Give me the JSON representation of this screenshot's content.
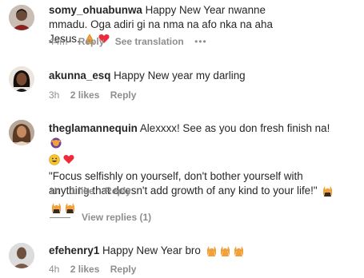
{
  "comments": [
    {
      "username": "somy_ohuabunwa",
      "text": "Happy New Year nwanne mmadu. Oga adiri gi na nma na afo nka na aha Jesus.",
      "time": "44m",
      "reply": "Reply",
      "see_translation": "See translation",
      "more": "•••",
      "emojis": [
        "folded-hands",
        "red-heart"
      ]
    },
    {
      "username": "akunna_esq",
      "text": "Happy New year my darling",
      "time": "3h",
      "likes": "2 likes",
      "reply": "Reply"
    },
    {
      "username": "theglamannequin",
      "text_line1": "Alexxxx! See as you don fresh finish na!",
      "text_line2": "\"Focus selfishly on yourself, don't bother yourself with anything that doesn't add growth of any kind to your life!\"",
      "time": "1h",
      "likes": "1 like",
      "reply": "Reply",
      "emojis": [
        "face-with-raised-hands",
        "grinning-face",
        "red-heart",
        "person-raising-hands",
        "person-raising-hands",
        "person-raising-hands"
      ]
    },
    {
      "username": "efehenry1",
      "text": "Happy New Year bro",
      "time": "4h",
      "likes": "2 likes",
      "reply": "Reply",
      "emojis": [
        "person-raising-hands",
        "person-raising-hands",
        "person-raising-hands"
      ]
    }
  ],
  "view_replies": "View replies (1)",
  "colors": {
    "text": "#262626",
    "meta": "#8e8e8e",
    "heart": "#ed2b3a",
    "emoji_skin": "#f2a13a"
  }
}
